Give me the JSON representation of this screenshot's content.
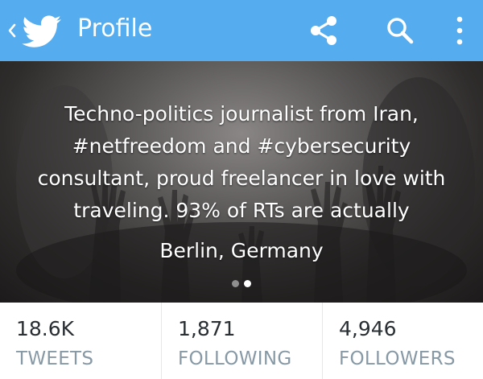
{
  "header": {
    "title": "Profile",
    "background_color": "#55acee",
    "icons": [
      "back-chevron-icon",
      "twitter-bird-icon",
      "share-icon",
      "search-icon",
      "more-vertical-icon"
    ]
  },
  "profile": {
    "bio": "Techno-politics journalist from Iran, #netfreedom and #cybersecurity consultant, proud freelancer in love with traveling. 93% of RTs are actually",
    "location": "Berlin, Germany",
    "carousel": {
      "pages": 2,
      "active_page": 2
    }
  },
  "stats": [
    {
      "value": "18.6K",
      "label": "TWEETS"
    },
    {
      "value": "1,871",
      "label": "FOLLOWING"
    },
    {
      "value": "4,946",
      "label": "FOLLOWERS"
    }
  ]
}
